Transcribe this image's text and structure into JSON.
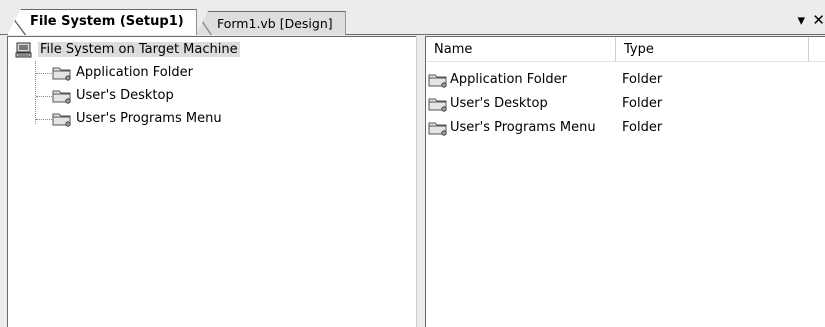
{
  "tabs": [
    {
      "label": "File System (Setup1)",
      "active": true
    },
    {
      "label": "Form1.vb [Design]",
      "active": false
    }
  ],
  "window_controls": {
    "dropdown_icon": "chevron-down-icon",
    "close_icon": "close-icon",
    "dropdown_glyph": "▾",
    "close_glyph": "✕"
  },
  "tree": {
    "root": {
      "label": "File System on Target Machine",
      "icon": "computer-icon"
    },
    "items": [
      {
        "label": "Application Folder",
        "icon": "folder-icon"
      },
      {
        "label": "User's Desktop",
        "icon": "folder-icon"
      },
      {
        "label": "User's Programs Menu",
        "icon": "folder-icon"
      }
    ]
  },
  "list": {
    "columns": {
      "name": "Name",
      "type": "Type"
    },
    "rows": [
      {
        "name": "Application Folder",
        "type": "Folder",
        "icon": "folder-icon"
      },
      {
        "name": "User's Desktop",
        "type": "Folder",
        "icon": "folder-icon"
      },
      {
        "name": "User's Programs Menu",
        "type": "Folder",
        "icon": "folder-icon"
      }
    ]
  },
  "colors": {
    "background": "#ececec",
    "pane": "#ffffff",
    "border": "#6a6a6a",
    "selection": "#dcdcdc"
  }
}
